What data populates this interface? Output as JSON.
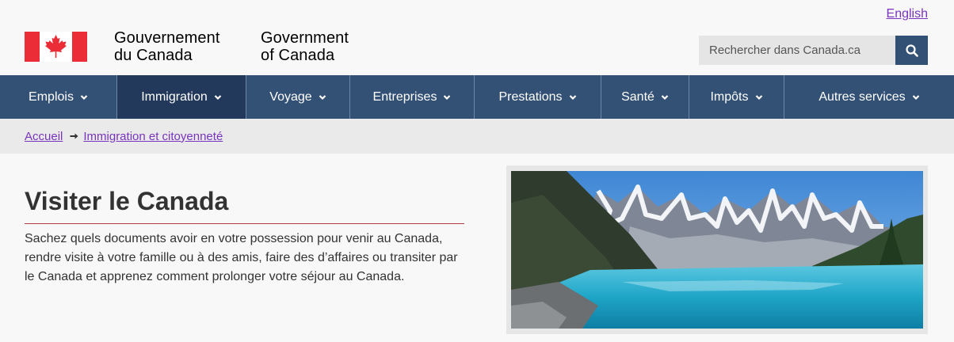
{
  "header": {
    "language_toggle": "English",
    "signature_fr_line1": "Gouvernement",
    "signature_fr_line2": "du Canada",
    "signature_en_line1": "Government",
    "signature_en_line2": "of Canada",
    "search_placeholder": "Rechercher dans Canada.ca"
  },
  "nav": {
    "items": [
      {
        "label": "Emplois"
      },
      {
        "label": "Immigration"
      },
      {
        "label": "Voyage"
      },
      {
        "label": "Entreprises"
      },
      {
        "label": "Prestations"
      },
      {
        "label": "Santé"
      },
      {
        "label": "Impôts"
      },
      {
        "label": "Autres services"
      }
    ]
  },
  "breadcrumb": {
    "home": "Accueil",
    "current": "Immigration et citoyenneté"
  },
  "main": {
    "title": "Visiter le Canada",
    "lead": "Sachez quels documents avoir en votre possession pour venir au Canada, rendre visite à votre famille ou à des amis, faire des d’affaires ou transiter par le Canada et apprenez comment prolonger votre séjour au Canada."
  },
  "colors": {
    "nav_bg": "#335075",
    "nav_active": "#23395b",
    "link": "#7834bc",
    "rule": "#af3c43",
    "flag_red": "#eb2d37"
  },
  "icons": {
    "search": "search-icon",
    "chevron": "chevron-down-icon",
    "breadcrumb_arrow": "arrow-right-icon"
  }
}
